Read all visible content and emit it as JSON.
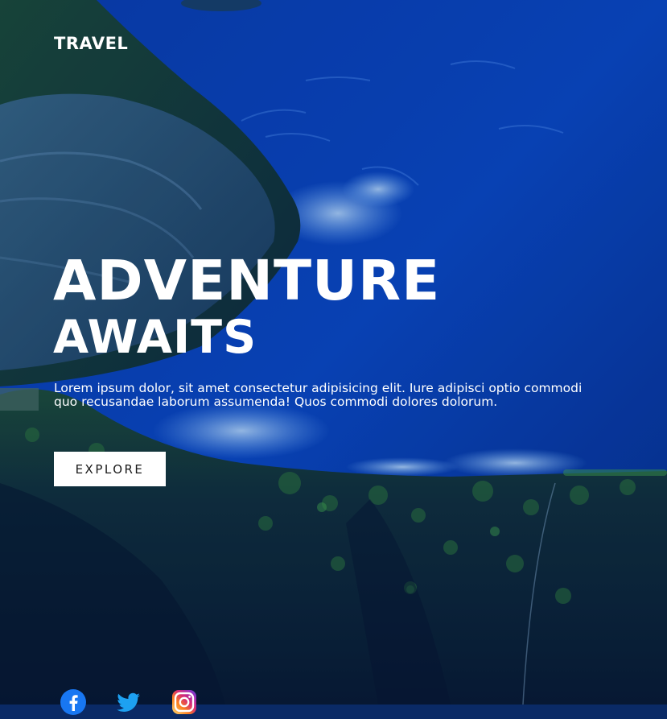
{
  "brand": {
    "logo_text": "TRAVEL"
  },
  "hero": {
    "headline_line1": "ADVENTURE",
    "headline_line2": "AWAITS",
    "description": "Lorem ipsum dolor, sit amet consectetur adipisicing elit. Iure adipisci optio commodi quo recusandae laborum assumenda! Quos commodi dolores dolorum.",
    "cta_label": "EXPLORE"
  },
  "social": [
    {
      "icon": "facebook-icon",
      "color": "#1877f2"
    },
    {
      "icon": "twitter-icon",
      "color": "#1da1f2"
    },
    {
      "icon": "instagram-icon",
      "color": "#d62976"
    }
  ],
  "colors": {
    "ocean": "#0a3fa8",
    "cliff_green": "#1f5a3a",
    "text": "#ffffff"
  }
}
